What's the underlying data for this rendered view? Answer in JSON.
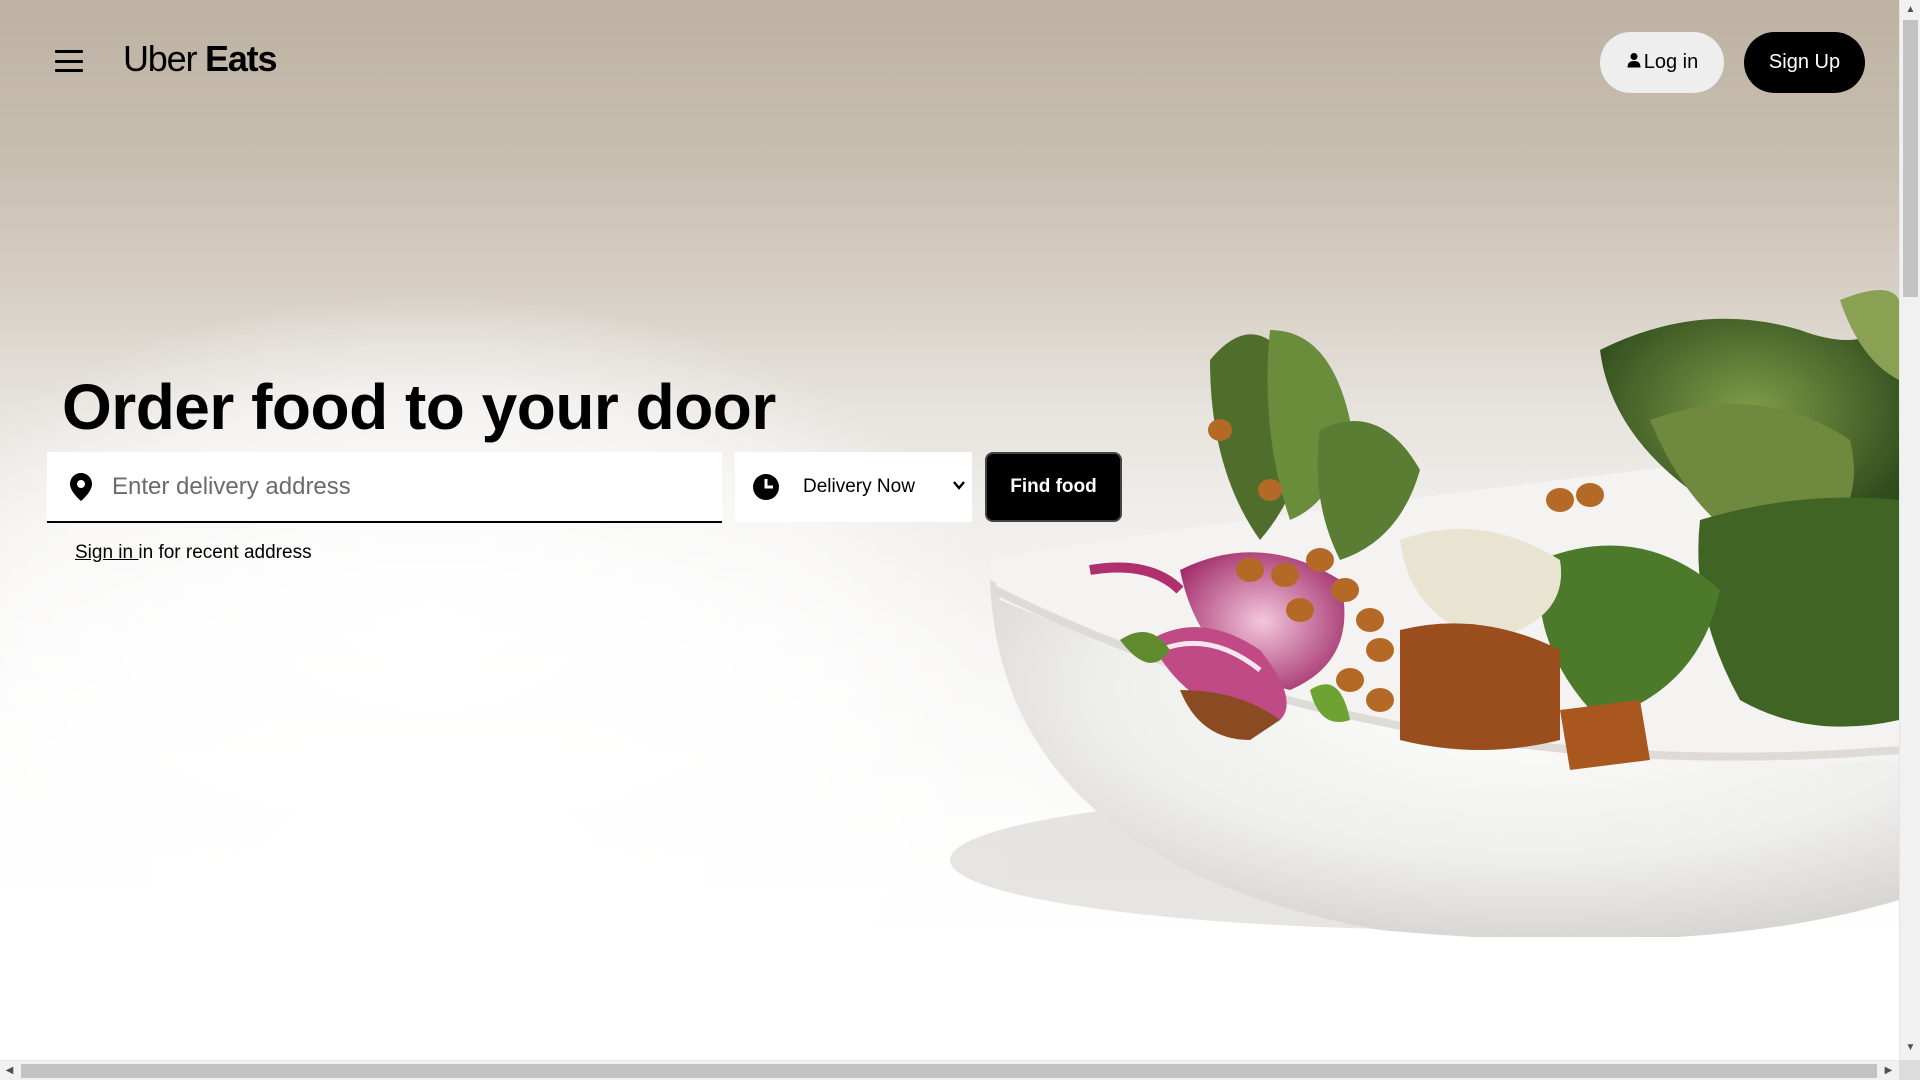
{
  "header": {
    "menu_icon": "hamburger-menu-icon",
    "logo": {
      "part1": "Uber",
      "part2": "Eats"
    },
    "login_label": "Log in",
    "login_icon": "person-icon",
    "signup_label": "Sign Up"
  },
  "hero": {
    "headline": "Order food to your door",
    "address": {
      "icon": "location-pin-icon",
      "placeholder": "Enter delivery address",
      "value": ""
    },
    "delivery_select": {
      "icon": "clock-icon",
      "selected": "Delivery Now",
      "chevron_icon": "chevron-down-icon"
    },
    "find_button_label": "Find food",
    "signin_link": "Sign in ",
    "signin_suffix": "in for recent address"
  },
  "colors": {
    "primary": "#000000",
    "login_bg": "#eeeeee",
    "hero_top": "#bdb2a2",
    "greens": "#5b7a3a"
  },
  "scrollbars": {
    "vertical_up_icon": "scroll-up-arrow-icon",
    "vertical_down_icon": "scroll-down-arrow-icon",
    "horizontal_left_icon": "scroll-left-arrow-icon",
    "horizontal_right_icon": "scroll-right-arrow-icon"
  }
}
